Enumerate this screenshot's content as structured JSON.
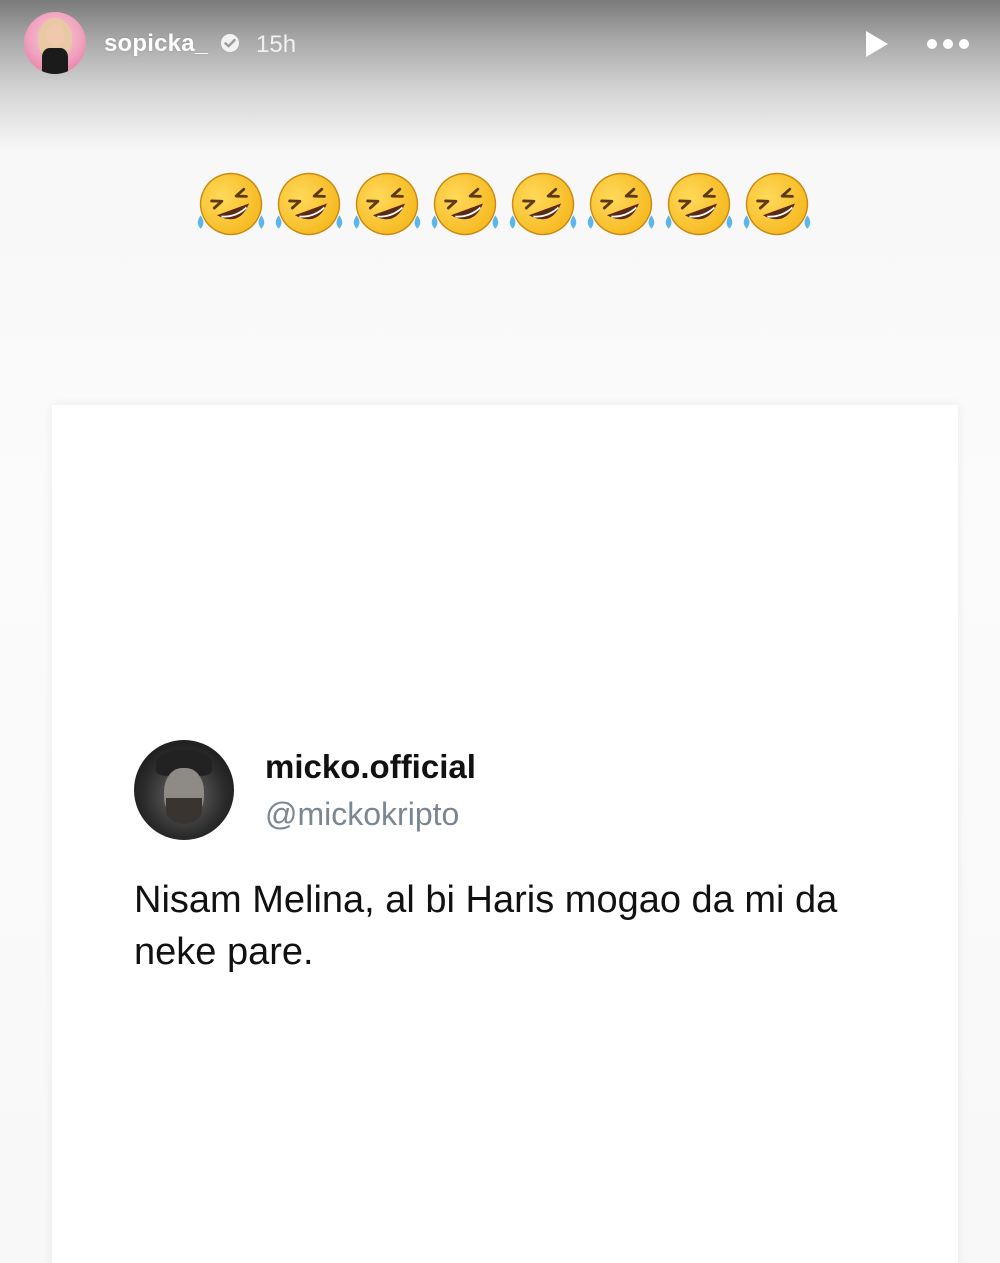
{
  "story": {
    "username": "sopicka_",
    "time": "15h",
    "icons": {
      "avatar": "profile-avatar",
      "verified": "verified-badge-icon",
      "play": "play-icon",
      "more": "more-options-icon"
    }
  },
  "emojis": {
    "emoji_name": "rolling-on-the-floor-laughing",
    "count": 8
  },
  "tweet": {
    "display_name": "micko.official",
    "handle": "@mickokripto",
    "text": "Nisam Melina, al bi Haris mogao da mi da neke pare."
  },
  "colors": {
    "accent": "#e26b9a",
    "handle_gray": "#7a8792",
    "emoji_yellow": "#f6b81e"
  }
}
